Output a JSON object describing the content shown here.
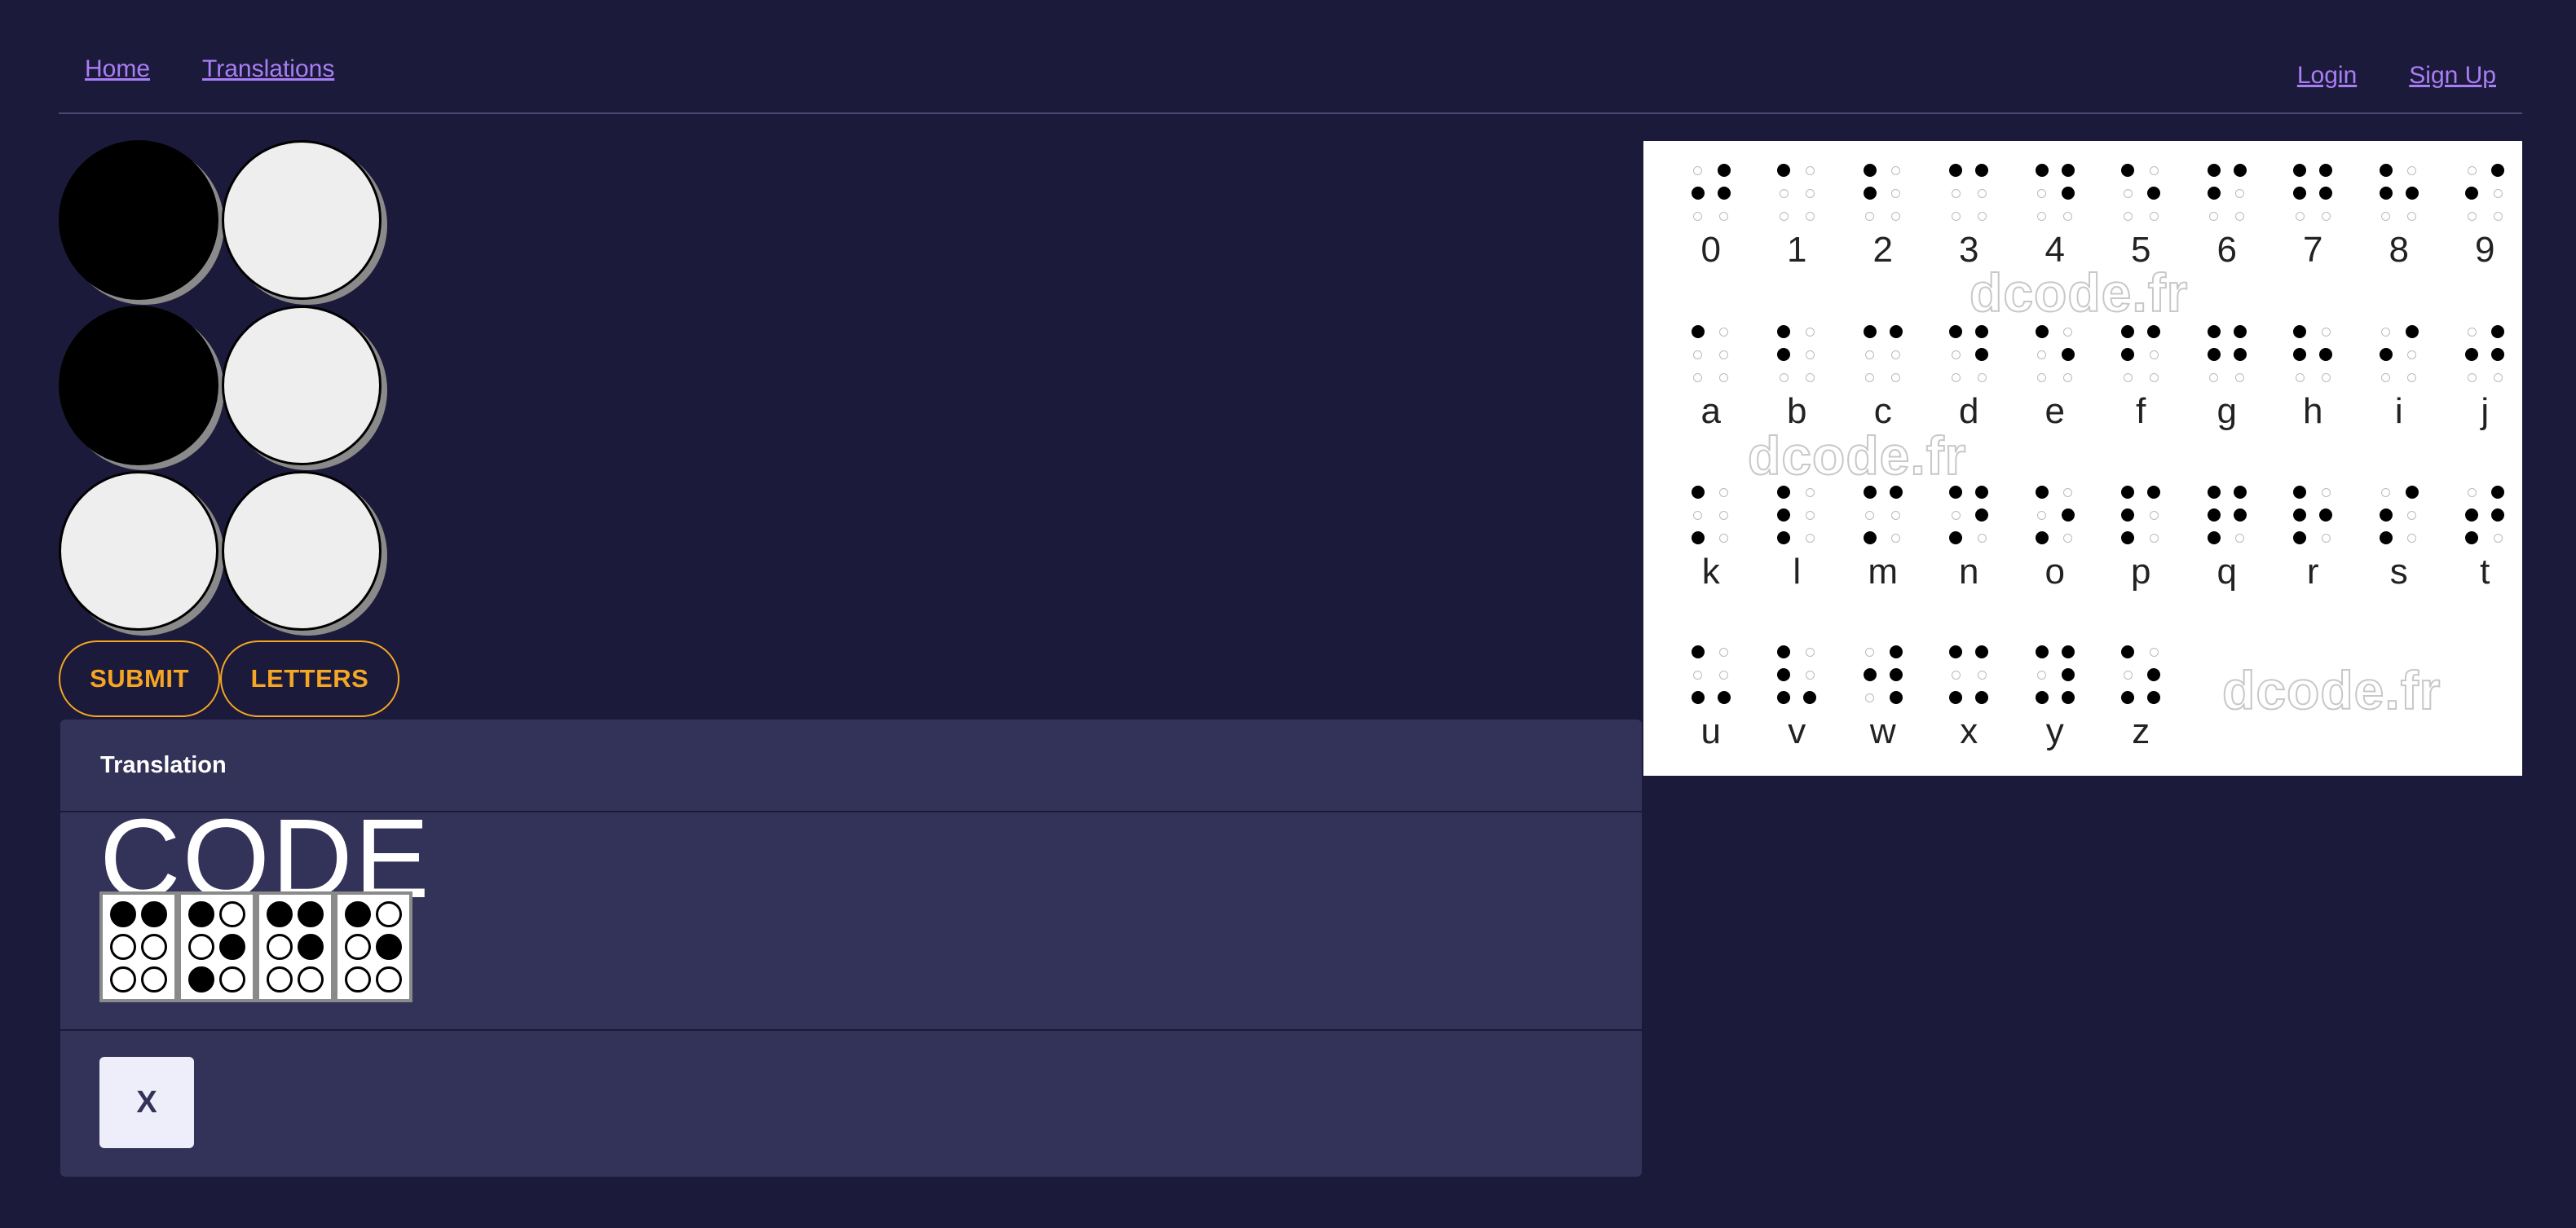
{
  "nav": {
    "home": "Home",
    "translations": "Translations",
    "login": "Login",
    "signup": "Sign Up"
  },
  "input_cells": [
    true,
    false,
    true,
    false,
    false,
    false
  ],
  "buttons": {
    "submit": "SUBMIT",
    "letters": "LETTERS"
  },
  "card": {
    "title": "Translation",
    "text": "CODE",
    "braille": [
      [
        true,
        true,
        false,
        false,
        false,
        false
      ],
      [
        true,
        false,
        false,
        true,
        true,
        false
      ],
      [
        true,
        true,
        false,
        true,
        false,
        false
      ],
      [
        true,
        false,
        false,
        true,
        false,
        false
      ]
    ],
    "clear_label": "X"
  },
  "reference": {
    "watermark": "dcode.fr",
    "rows": [
      [
        [
          "0",
          [
            0,
            1,
            1,
            1,
            0,
            0
          ]
        ],
        [
          "1",
          [
            1,
            0,
            0,
            0,
            0,
            0
          ]
        ],
        [
          "2",
          [
            1,
            0,
            1,
            0,
            0,
            0
          ]
        ],
        [
          "3",
          [
            1,
            1,
            0,
            0,
            0,
            0
          ]
        ],
        [
          "4",
          [
            1,
            1,
            0,
            1,
            0,
            0
          ]
        ],
        [
          "5",
          [
            1,
            0,
            0,
            1,
            0,
            0
          ]
        ],
        [
          "6",
          [
            1,
            1,
            1,
            0,
            0,
            0
          ]
        ],
        [
          "7",
          [
            1,
            1,
            1,
            1,
            0,
            0
          ]
        ],
        [
          "8",
          [
            1,
            0,
            1,
            1,
            0,
            0
          ]
        ],
        [
          "9",
          [
            0,
            1,
            1,
            0,
            0,
            0
          ]
        ]
      ],
      [
        [
          "a",
          [
            1,
            0,
            0,
            0,
            0,
            0
          ]
        ],
        [
          "b",
          [
            1,
            0,
            1,
            0,
            0,
            0
          ]
        ],
        [
          "c",
          [
            1,
            1,
            0,
            0,
            0,
            0
          ]
        ],
        [
          "d",
          [
            1,
            1,
            0,
            1,
            0,
            0
          ]
        ],
        [
          "e",
          [
            1,
            0,
            0,
            1,
            0,
            0
          ]
        ],
        [
          "f",
          [
            1,
            1,
            1,
            0,
            0,
            0
          ]
        ],
        [
          "g",
          [
            1,
            1,
            1,
            1,
            0,
            0
          ]
        ],
        [
          "h",
          [
            1,
            0,
            1,
            1,
            0,
            0
          ]
        ],
        [
          "i",
          [
            0,
            1,
            1,
            0,
            0,
            0
          ]
        ],
        [
          "j",
          [
            0,
            1,
            1,
            1,
            0,
            0
          ]
        ]
      ],
      [
        [
          "k",
          [
            1,
            0,
            0,
            0,
            1,
            0
          ]
        ],
        [
          "l",
          [
            1,
            0,
            1,
            0,
            1,
            0
          ]
        ],
        [
          "m",
          [
            1,
            1,
            0,
            0,
            1,
            0
          ]
        ],
        [
          "n",
          [
            1,
            1,
            0,
            1,
            1,
            0
          ]
        ],
        [
          "o",
          [
            1,
            0,
            0,
            1,
            1,
            0
          ]
        ],
        [
          "p",
          [
            1,
            1,
            1,
            0,
            1,
            0
          ]
        ],
        [
          "q",
          [
            1,
            1,
            1,
            1,
            1,
            0
          ]
        ],
        [
          "r",
          [
            1,
            0,
            1,
            1,
            1,
            0
          ]
        ],
        [
          "s",
          [
            0,
            1,
            1,
            0,
            1,
            0
          ]
        ],
        [
          "t",
          [
            0,
            1,
            1,
            1,
            1,
            0
          ]
        ]
      ],
      [
        [
          "u",
          [
            1,
            0,
            0,
            0,
            1,
            1
          ]
        ],
        [
          "v",
          [
            1,
            0,
            1,
            0,
            1,
            1
          ]
        ],
        [
          "w",
          [
            0,
            1,
            1,
            1,
            0,
            1
          ]
        ],
        [
          "x",
          [
            1,
            1,
            0,
            0,
            1,
            1
          ]
        ],
        [
          "y",
          [
            1,
            1,
            0,
            1,
            1,
            1
          ]
        ],
        [
          "z",
          [
            1,
            0,
            0,
            1,
            1,
            1
          ]
        ]
      ]
    ]
  }
}
